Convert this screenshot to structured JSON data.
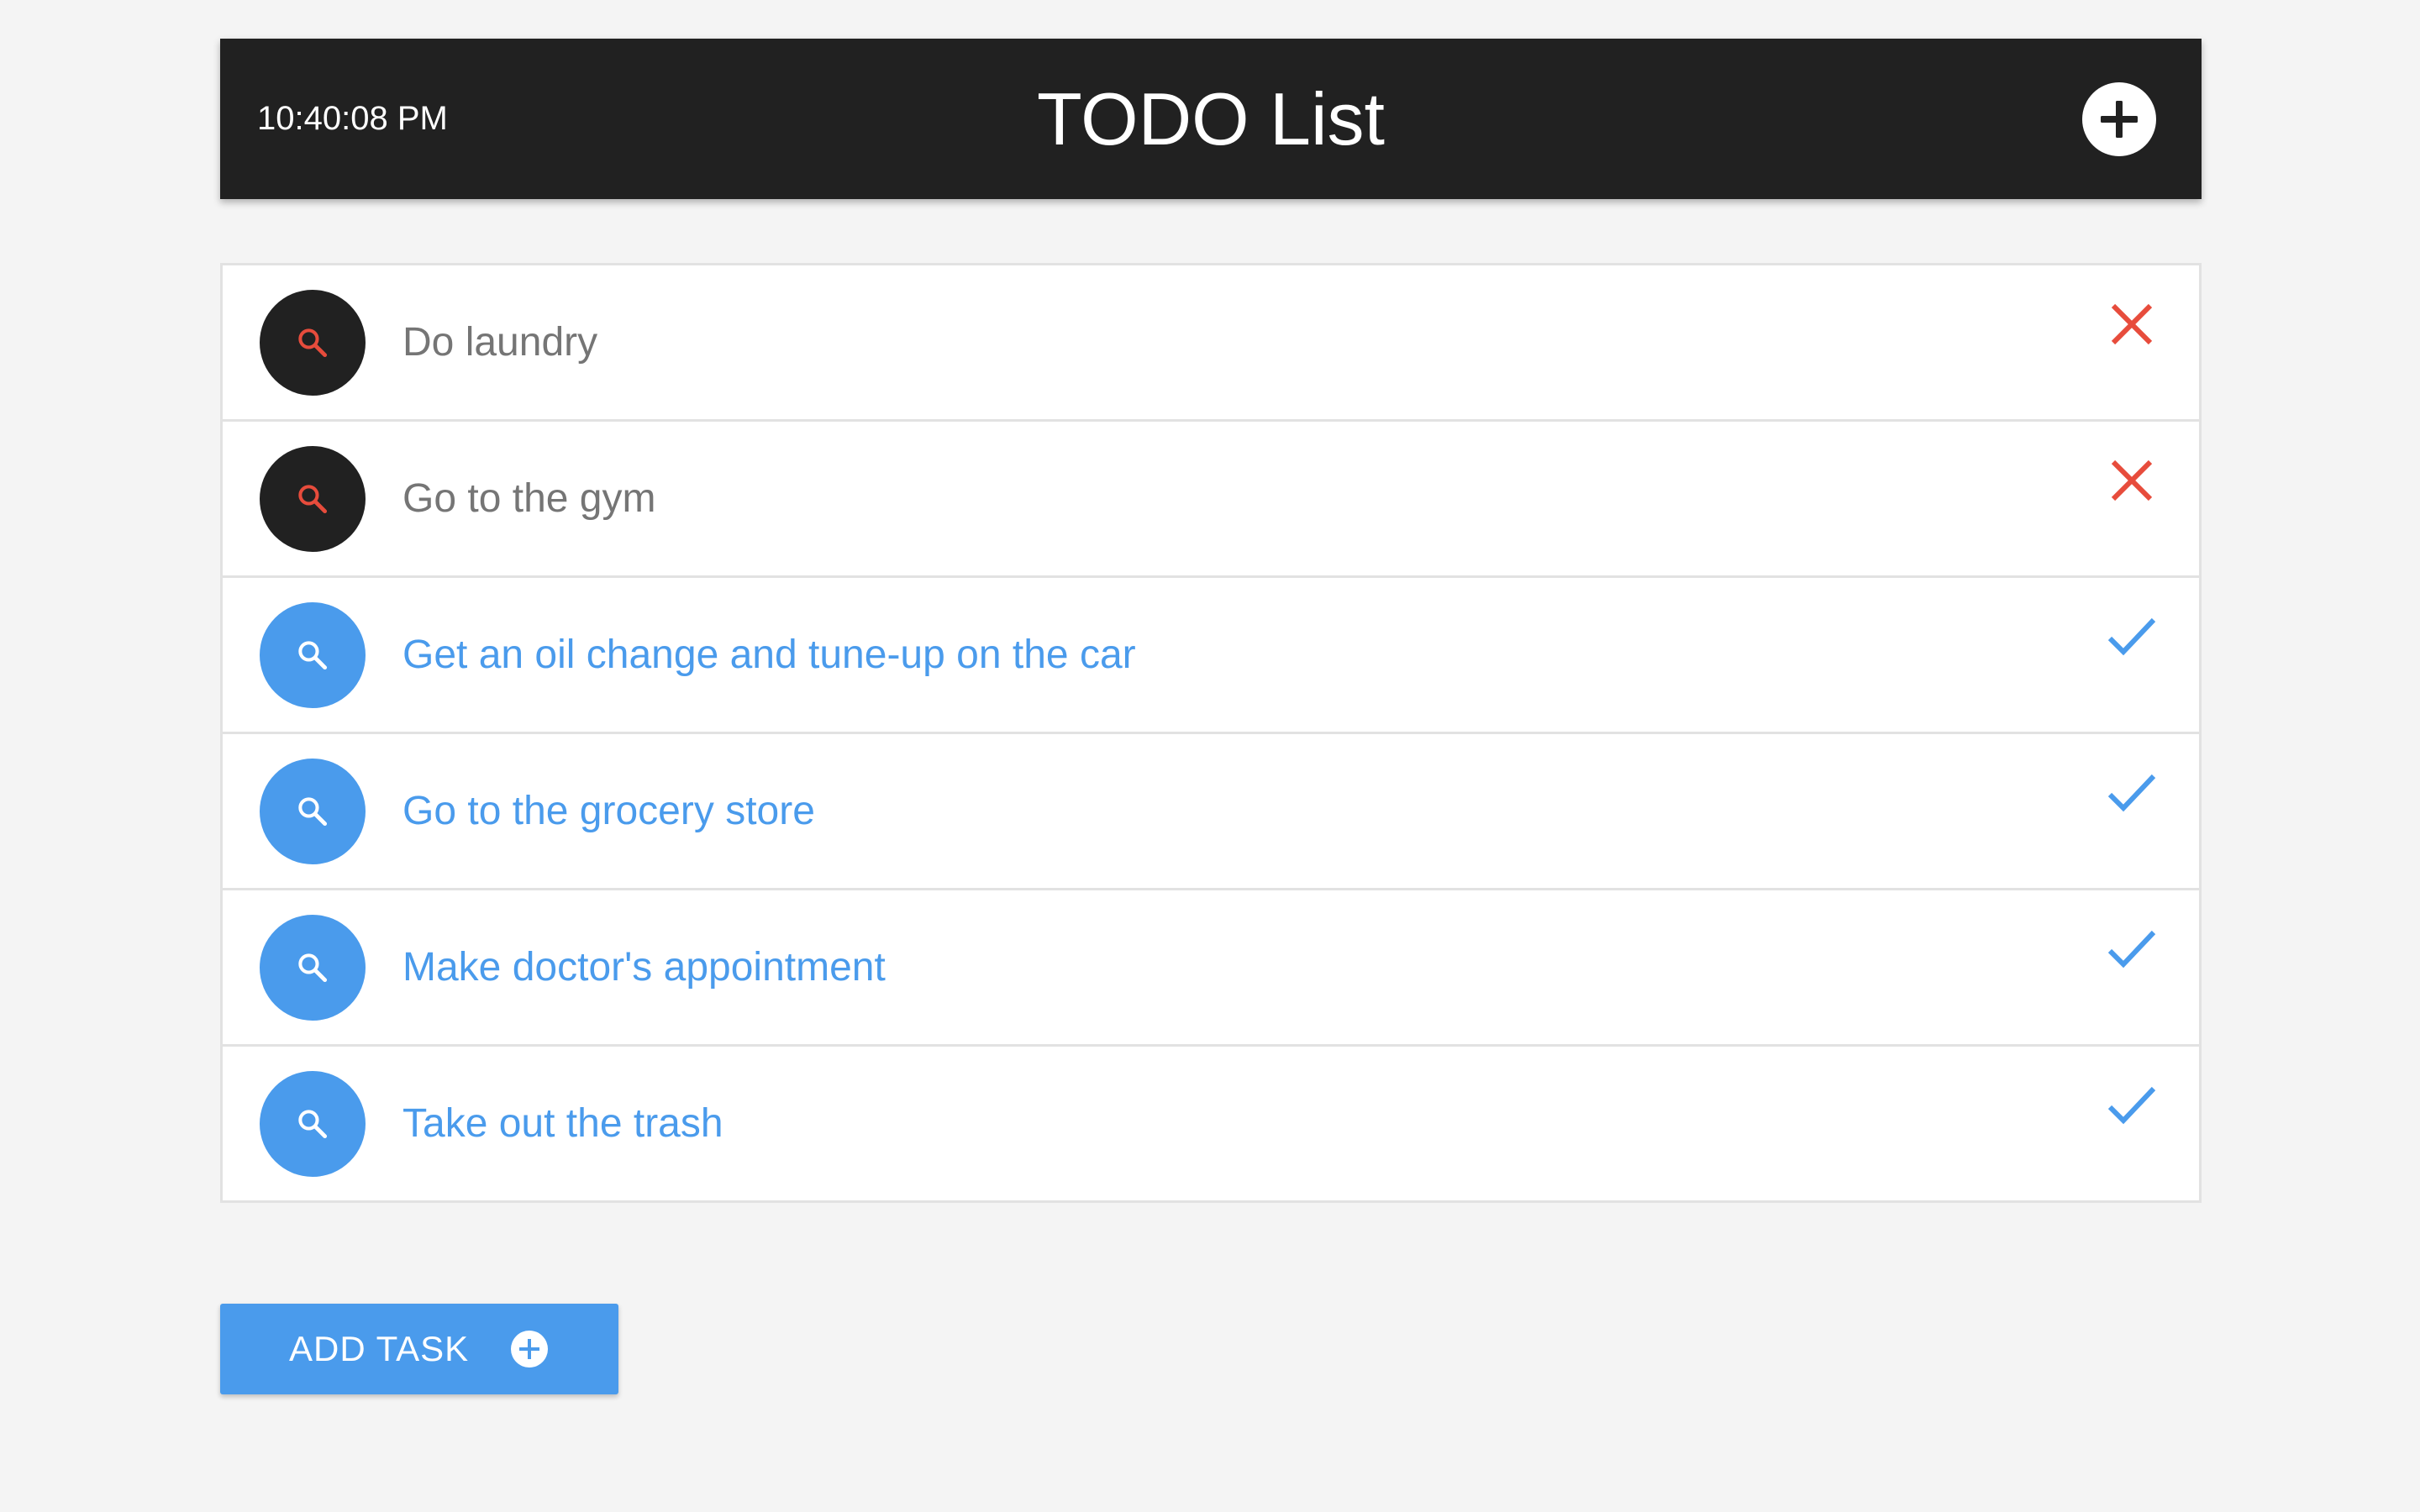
{
  "header": {
    "clock": "10:40:08 PM",
    "title": "TODO List",
    "add_icon": "plus-circle-icon"
  },
  "colors": {
    "header_bg": "#212121",
    "page_bg": "#f4f4f4",
    "pending_avatar": "#212121",
    "pending_text": "#757575",
    "pending_action": "#e74c3c",
    "done_avatar": "#4a9bec",
    "done_text": "#4a9bec",
    "done_action": "#4a9bec"
  },
  "tasks": [
    {
      "text": "Do laundry",
      "done": false,
      "avatar_icon": "search-icon",
      "action_icon": "close-icon"
    },
    {
      "text": "Go to the gym",
      "done": false,
      "avatar_icon": "search-icon",
      "action_icon": "close-icon"
    },
    {
      "text": "Get an oil change and tune-up on the car",
      "done": true,
      "avatar_icon": "search-icon",
      "action_icon": "check-icon"
    },
    {
      "text": "Go to the grocery store",
      "done": true,
      "avatar_icon": "search-icon",
      "action_icon": "check-icon"
    },
    {
      "text": "Make doctor's appointment",
      "done": true,
      "avatar_icon": "search-icon",
      "action_icon": "check-icon"
    },
    {
      "text": "Take out the trash",
      "done": true,
      "avatar_icon": "search-icon",
      "action_icon": "check-icon"
    }
  ],
  "add_task": {
    "label": "ADD TASK",
    "icon": "plus-circle-icon"
  }
}
